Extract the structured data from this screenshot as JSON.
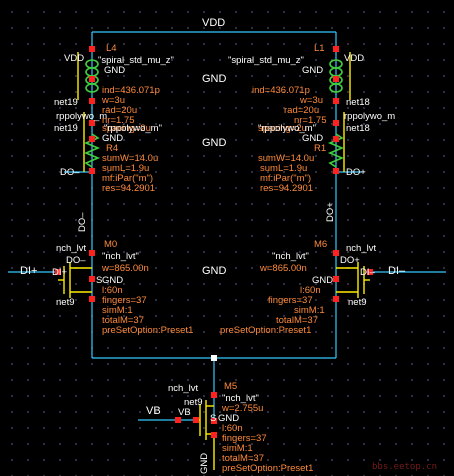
{
  "nets": {
    "vdd": "VDD",
    "gnd": "GND",
    "net19": "net19",
    "net18": "net18",
    "net9": "net9",
    "do_minus": "DO–",
    "do_plus": "DO+",
    "do_minus_v": "DO–",
    "do_plus_v": "DO+",
    "di_plus": "DI+",
    "di_minus": "DI–",
    "vb": "VB",
    "s": "S",
    "b": "B",
    "d": "D"
  },
  "l4": {
    "name": "L4",
    "cell": "\"spiral_std_mu_z\"",
    "ind": "ind=436.071p",
    "w": "w=3u",
    "rad": "rad=20u",
    "nr": "nr=1.75",
    "spacing": "spacing=2u"
  },
  "l1": {
    "name": "L1",
    "cell": "\"spiral_std_mu_z\"",
    "ind": "ind=436.071p",
    "w": "w=3u",
    "rad": "rad=20u",
    "nr": "nr=1.75",
    "spacing": "spacing=2u"
  },
  "r4": {
    "name": "R4",
    "model": "rppolywo_m",
    "cell": "\"rppolywo_m\"",
    "sumW": "sumW=14.0u",
    "sumL": "sumL=1.9u",
    "mf": "mf:iPar(\"m\")",
    "res": "res=94.2901"
  },
  "r1": {
    "name": "R1",
    "model": "rppolywo_m",
    "cell": "\"rppolywo_m\"",
    "sumW": "sumW=14.0u",
    "sumL": "sumL=1.9u",
    "mf": "mf:iPar(\"m\")",
    "res": "res=94.2901"
  },
  "m0": {
    "name": "M0",
    "model": "nch_lvt",
    "cell": "\"nch_lvt\"",
    "w": "w=865.00n",
    "l": "l:60n",
    "fingers": "fingers=37",
    "simM": "simM:1",
    "totalM": "totalM=37",
    "preset": "preSetOption:Preset1"
  },
  "m6": {
    "name": "M6",
    "model": "nch_lvt",
    "cell": "\"nch_lvt\"",
    "w": "w=865.00n",
    "l": "l:60n",
    "fingers": "fingers=37",
    "simM": "simM:1",
    "totalM": "totalM=37",
    "preset": "preSetOption:Preset1"
  },
  "m5": {
    "name": "M5",
    "model": "nch_lvt",
    "cell": "\"nch_lvt\"",
    "w": "w=2.755u",
    "l": "l:60n",
    "fingers": "fingers=37",
    "simM": "simM:1",
    "totalM": "totalM=37",
    "preset": "preSetOption:Preset1"
  },
  "watermark": "bbs.eetop.cn",
  "colors": {
    "wire": "#35c8ff",
    "text": "#ffffff",
    "param": "#ff8a3a",
    "pin": "#ff2020",
    "inductor": "#40d040",
    "resistor": "#40d040",
    "device": "#ffee00"
  }
}
